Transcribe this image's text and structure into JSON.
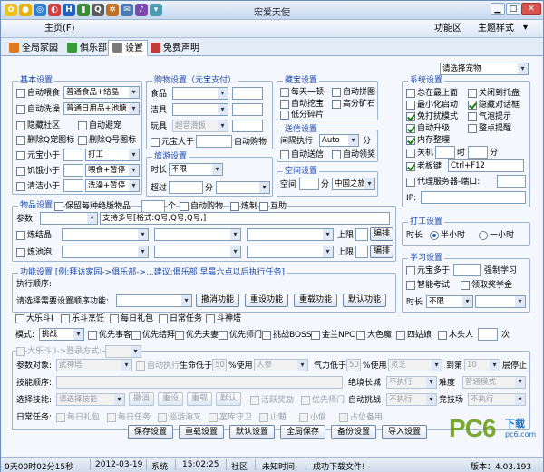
{
  "window": {
    "title": "宏爱天使",
    "close": "✕",
    "min": "▁",
    "max": "□"
  },
  "menu": {
    "home": "主页(F)",
    "function_area": "功能区",
    "theme": "主题样式"
  },
  "tabs": [
    "全局家园",
    "俱乐部",
    "设置",
    "免费声明"
  ],
  "basic": {
    "title": "基本设置",
    "auto_feed": "自动喂食",
    "auto_feed_val": "普通食品+结晶",
    "auto_wash": "自动洗澡",
    "auto_wash_val": "普通日用品+池塘",
    "hide_community": "隐藏社区",
    "auto_shelter": "自动避宠",
    "del_q_pet_icon": "删除Q宠图标",
    "del_q_icon": "删除Q号图标",
    "coin_less": "元宝小于",
    "coin_action": "打工",
    "hunger_less": "饥饿小于",
    "hunger_action": "喂食+暂停",
    "clean_less": "清洁小于",
    "clean_action": "洗澡+暂停"
  },
  "buy": {
    "title": "购物设置（元宝支付）",
    "food": "食品",
    "washing": "洁具",
    "toy": "玩具",
    "toy_val": "超音滑板",
    "coin_gt": "元宝大于",
    "auto_shop": "自动购物"
  },
  "travel": {
    "title": "旅游设置",
    "duration": "时长",
    "duration_val": "不限",
    "exceed": "超过",
    "minutes": "分"
  },
  "treasure": {
    "title": "藏宝设置",
    "daily": "每天一顿",
    "auto_puzzle": "自动拼图",
    "auto_dig": "自动挖宝",
    "advanced_ore": "高分矿石",
    "low_fragment": "低分碎片"
  },
  "send": {
    "title": "送信设置",
    "interval": "间隔执行",
    "interval_val": "Auto",
    "minutes": "分",
    "auto_send": "自动送信",
    "auto_receive": "自动领奖"
  },
  "space": {
    "title": "空间设置",
    "space": "空间",
    "minutes": "分",
    "place": "中国之旅"
  },
  "system": {
    "title": "系统设置",
    "pet_select": "请选择宠物",
    "on_top": "总在最上面",
    "close_to_tray": "关闭到托盘",
    "min_start": "最小化启动",
    "hide_dialog": "隐藏对话框",
    "no_disturb": "免打扰模式",
    "bubble": "气泡提示",
    "auto_upgrade": "自动升级",
    "hourly_alert": "整点提醒",
    "memory": "内存整理",
    "shutdown": "关机",
    "hour": "时",
    "minute": "分",
    "boss_key": "老板键",
    "boss_key_val": "Ctrl+F12",
    "proxy": "代理服务器-端口:",
    "ip": "IP:"
  },
  "work": {
    "title": "打工设置",
    "duration": "时长",
    "half_hour": "半小时",
    "one_hour": "一小时"
  },
  "study": {
    "title": "学习设置",
    "coin_gt": "元宝多于",
    "force_study": "强制学习",
    "smart_exam": "智能考试",
    "scholarship": "领取奖学金",
    "duration": "时长",
    "duration_val": "不限"
  },
  "items": {
    "title": "物品设置",
    "keep": "保留每种绝版物品",
    "count_unit": "个",
    "auto_buy": "自动购物",
    "craft": "炼制",
    "mutual": "互助",
    "params": "参数",
    "params_val": "支持多号[格式:Q号,Q号,Q号,]",
    "crystal": "炼结晶",
    "pond": "炼池泡",
    "upper": "上限",
    "arrange": "编排"
  },
  "func": {
    "title": "功能设置 [例:拜访家园->俱乐部->...建议:俱乐部 早晨六点以后执行任务]",
    "order": "执行顺序:",
    "choose": "请选择需要设置顺序功能:",
    "cancel": "撤消功能",
    "reset": "重设功能",
    "reload": "重载功能",
    "default": "默认功能",
    "tasks": [
      "大乐斗I",
      "乐斗烹饪",
      "每日礼包",
      "日常任务",
      "斗神塔"
    ],
    "mode": "模式:",
    "mode_val": "挑战",
    "mode_opts": [
      "优先事客",
      "优先结拜",
      "优先夫妻",
      "优先师门",
      "挑战BOSS",
      "金兰NPC",
      "大色魔",
      "四姑娘",
      "木头人"
    ],
    "times": "次"
  },
  "fight": {
    "title": "大乐斗II->登录方式:",
    "target": "参数对象:",
    "target_val": "武神塔",
    "auto_exec": "自动执行",
    "life_lt": "生命低于",
    "life_pct": "50",
    "use": "%使用",
    "life_item": "人参",
    "qi_lt": "气力低于",
    "qi_pct": "50",
    "use2": "%使用",
    "qi_item": "灵芝",
    "reach": "到第",
    "floor": "10",
    "stop": "层停止",
    "skill_order": "技能顺序:",
    "absolute": "绝境长城",
    "absolute_val": "不执行",
    "diff": "难度",
    "diff_val": "普通模式",
    "select_skill": "选择技能:",
    "select_skill_val": "请选择技能",
    "cancel": "撤消",
    "reset": "重设",
    "reload": "重载",
    "default": "默认",
    "event": "活跃奖励",
    "mentor": "优先师门",
    "auto_challenge": "自动挑战",
    "auto_challenge_val": "不执行",
    "arena": "竞技场",
    "arena_val": "不执行",
    "daily": "日常任务:",
    "daily_items": [
      "每日礼包",
      "每日任务",
      "巡游海叉",
      "室库守卫",
      "山魈",
      "小偷",
      "占位备用"
    ]
  },
  "bottom_buttons": [
    "保存设置",
    "重载设置",
    "默认设置",
    "全局保存",
    "备份设置",
    "导入设置"
  ],
  "status": {
    "time": "0天00时02分15秒",
    "date": "2012-03-19",
    "system": "系统",
    "clock": "15:02:25",
    "community": "社区",
    "unknown": "未知时间",
    "msg": "成功下载文件!",
    "version": "版本：4.03.193"
  },
  "watermark": {
    "brand": "PC6",
    "sub": "下载",
    "url": "pc6.com"
  },
  "colors": {
    "accent": "#1d48a8",
    "title_bg": "#c6d8ef",
    "window": "#eef3fa"
  }
}
